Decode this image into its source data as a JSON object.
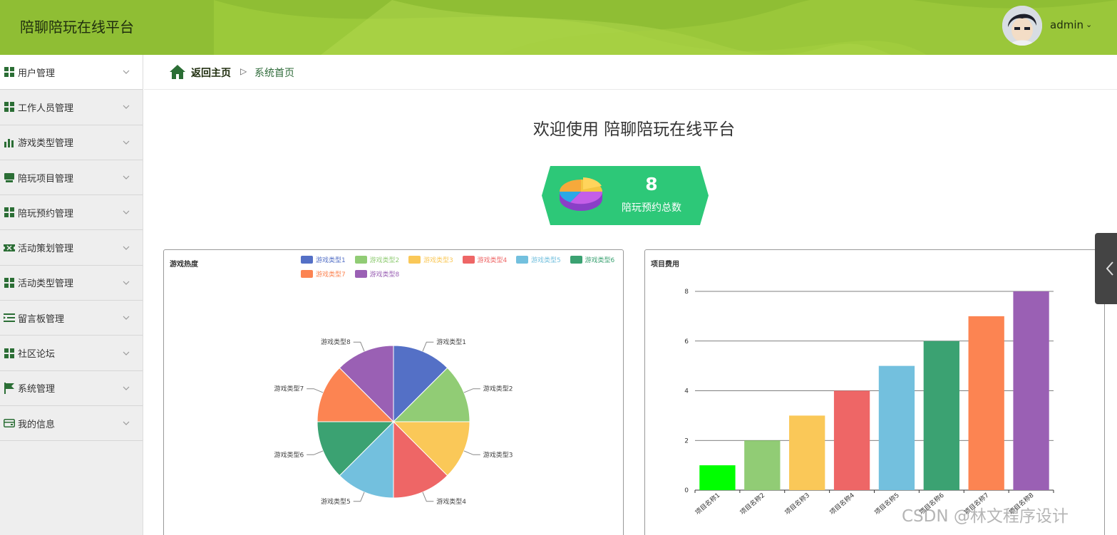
{
  "header": {
    "app_title": "陪聊陪玩在线平台",
    "user_name": "admin",
    "user_caret": "⌄",
    "accent_color": "#8fbe34"
  },
  "sidebar": {
    "items": [
      {
        "label": "用户管理",
        "icon": "grid-icon",
        "active": true
      },
      {
        "label": "工作人员管理",
        "icon": "grid-icon"
      },
      {
        "label": "游戏类型管理",
        "icon": "bar-chart-icon"
      },
      {
        "label": "陪玩项目管理",
        "icon": "monitor-icon"
      },
      {
        "label": "陪玩预约管理",
        "icon": "grid-icon"
      },
      {
        "label": "活动策划管理",
        "icon": "ticket-icon"
      },
      {
        "label": "活动类型管理",
        "icon": "grid-icon"
      },
      {
        "label": "留言板管理",
        "icon": "list-icon"
      },
      {
        "label": "社区论坛",
        "icon": "grid-icon"
      },
      {
        "label": "系统管理",
        "icon": "flag-icon"
      },
      {
        "label": "我的信息",
        "icon": "card-icon"
      }
    ]
  },
  "breadcrumb": {
    "home": "返回主页",
    "separator": "▷",
    "current": "系统首页"
  },
  "welcome": "欢迎使用 陪聊陪玩在线平台",
  "stat": {
    "value": "8",
    "label": "陪玩预约总数",
    "color": "#2dc878"
  },
  "chart_data": [
    {
      "type": "pie",
      "title": "游戏热度",
      "categories": [
        "游戏类型1",
        "游戏类型2",
        "游戏类型3",
        "游戏类型4",
        "游戏类型5",
        "游戏类型6",
        "游戏类型7",
        "游戏类型8"
      ],
      "values": [
        1,
        1,
        1,
        1,
        1,
        1,
        1,
        1
      ],
      "colors": [
        "#5470c6",
        "#91cc75",
        "#fac858",
        "#ee6666",
        "#73c0de",
        "#3ba272",
        "#fc8452",
        "#9a60b4"
      ],
      "legend": "top-right"
    },
    {
      "type": "bar",
      "title": "项目费用",
      "categories": [
        "项目名称1",
        "项目名称2",
        "项目名称3",
        "项目名称4",
        "项目名称5",
        "项目名称6",
        "项目名称7",
        "项目名称8"
      ],
      "values": [
        1,
        2,
        3,
        4,
        5,
        6,
        7,
        8
      ],
      "colors": [
        "#00ff00",
        "#91cc75",
        "#fac858",
        "#ee6666",
        "#73c0de",
        "#3ba272",
        "#fc8452",
        "#9a60b4"
      ],
      "ylim": [
        0,
        8
      ],
      "yticks": [
        0,
        2,
        4,
        6,
        8
      ],
      "grid": true
    }
  ],
  "watermark": "CSDN @林文程序设计"
}
